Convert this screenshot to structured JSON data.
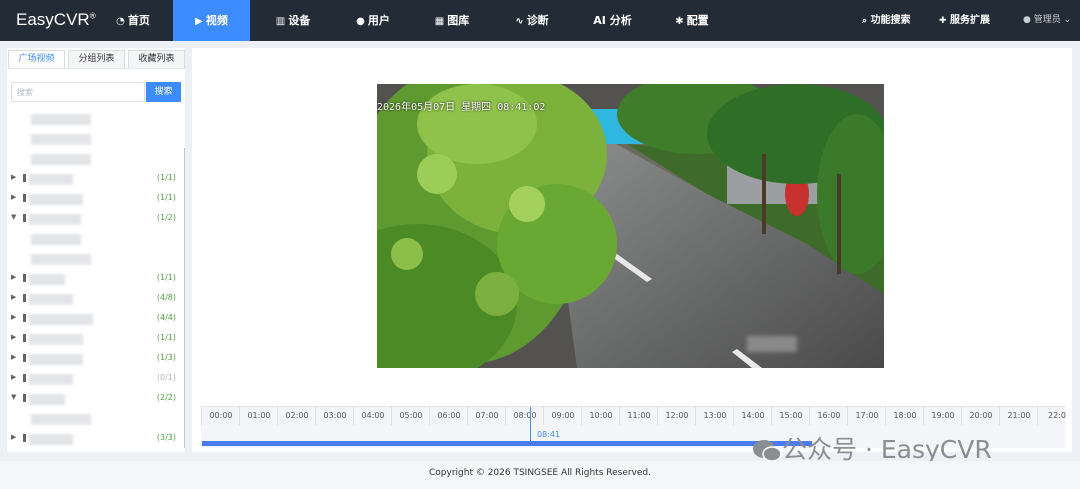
{
  "app": {
    "brand": "EasyCVR",
    "brand_mark": "®"
  },
  "nav": {
    "items": [
      {
        "label": "首页",
        "icon": "dashboard-icon",
        "active": false
      },
      {
        "label": "视频",
        "icon": "play-circle-icon",
        "active": true
      },
      {
        "label": "设备",
        "icon": "device-icon",
        "active": false
      },
      {
        "label": "用户",
        "icon": "user-icon",
        "active": false
      },
      {
        "label": "图库",
        "icon": "gallery-icon",
        "active": false
      },
      {
        "label": "诊断",
        "icon": "pulse-icon",
        "active": false
      },
      {
        "label": "AI 分析",
        "icon": "",
        "active": false
      },
      {
        "label": "配置",
        "icon": "gear-icon",
        "active": false
      }
    ],
    "search_label": "功能搜索",
    "extend_label": "服务扩展",
    "user_label": "管理员"
  },
  "sidebar": {
    "tabs": [
      "广场视频",
      "分组列表",
      "收藏列表"
    ],
    "active_tab": 0,
    "search_placeholder": "搜索",
    "search_button": "搜索",
    "rows": [
      {
        "type": "child",
        "count": ""
      },
      {
        "type": "child",
        "count": ""
      },
      {
        "type": "child",
        "count": ""
      },
      {
        "type": "device",
        "expanded": false,
        "count": "(1/1)"
      },
      {
        "type": "device",
        "expanded": false,
        "count": "(1/1)"
      },
      {
        "type": "device",
        "expanded": true,
        "count": "(1/2)"
      },
      {
        "type": "child",
        "count": ""
      },
      {
        "type": "child",
        "count": ""
      },
      {
        "type": "device",
        "expanded": false,
        "count": "(1/1)"
      },
      {
        "type": "device",
        "expanded": false,
        "count": "(4/8)"
      },
      {
        "type": "device",
        "expanded": false,
        "count": "(4/4)"
      },
      {
        "type": "device",
        "expanded": false,
        "count": "(1/1)"
      },
      {
        "type": "device",
        "expanded": false,
        "count": "(1/3)"
      },
      {
        "type": "device",
        "expanded": false,
        "count": "(0/1)",
        "offline": true
      },
      {
        "type": "device",
        "expanded": true,
        "count": "(2/2)"
      },
      {
        "type": "child",
        "count": ""
      },
      {
        "type": "device",
        "expanded": false,
        "count": "(3/3)"
      }
    ]
  },
  "player": {
    "osd": "2026年05月07日 星期四 08:41:02"
  },
  "timeline": {
    "hours": [
      "00:00",
      "01:00",
      "02:00",
      "03:00",
      "04:00",
      "05:00",
      "06:00",
      "07:00",
      "08:00",
      "09:00",
      "10:00",
      "11:00",
      "12:00",
      "13:00",
      "14:00",
      "15:00",
      "16:00",
      "17:00",
      "18:00",
      "19:00",
      "20:00",
      "21:00",
      "22:0"
    ],
    "cursor_time": "08:41"
  },
  "watermark": "公众号 · EasyCVR",
  "footer": {
    "copyright": "Copyright © 2026 TSINGSEE All Rights Reserved."
  }
}
